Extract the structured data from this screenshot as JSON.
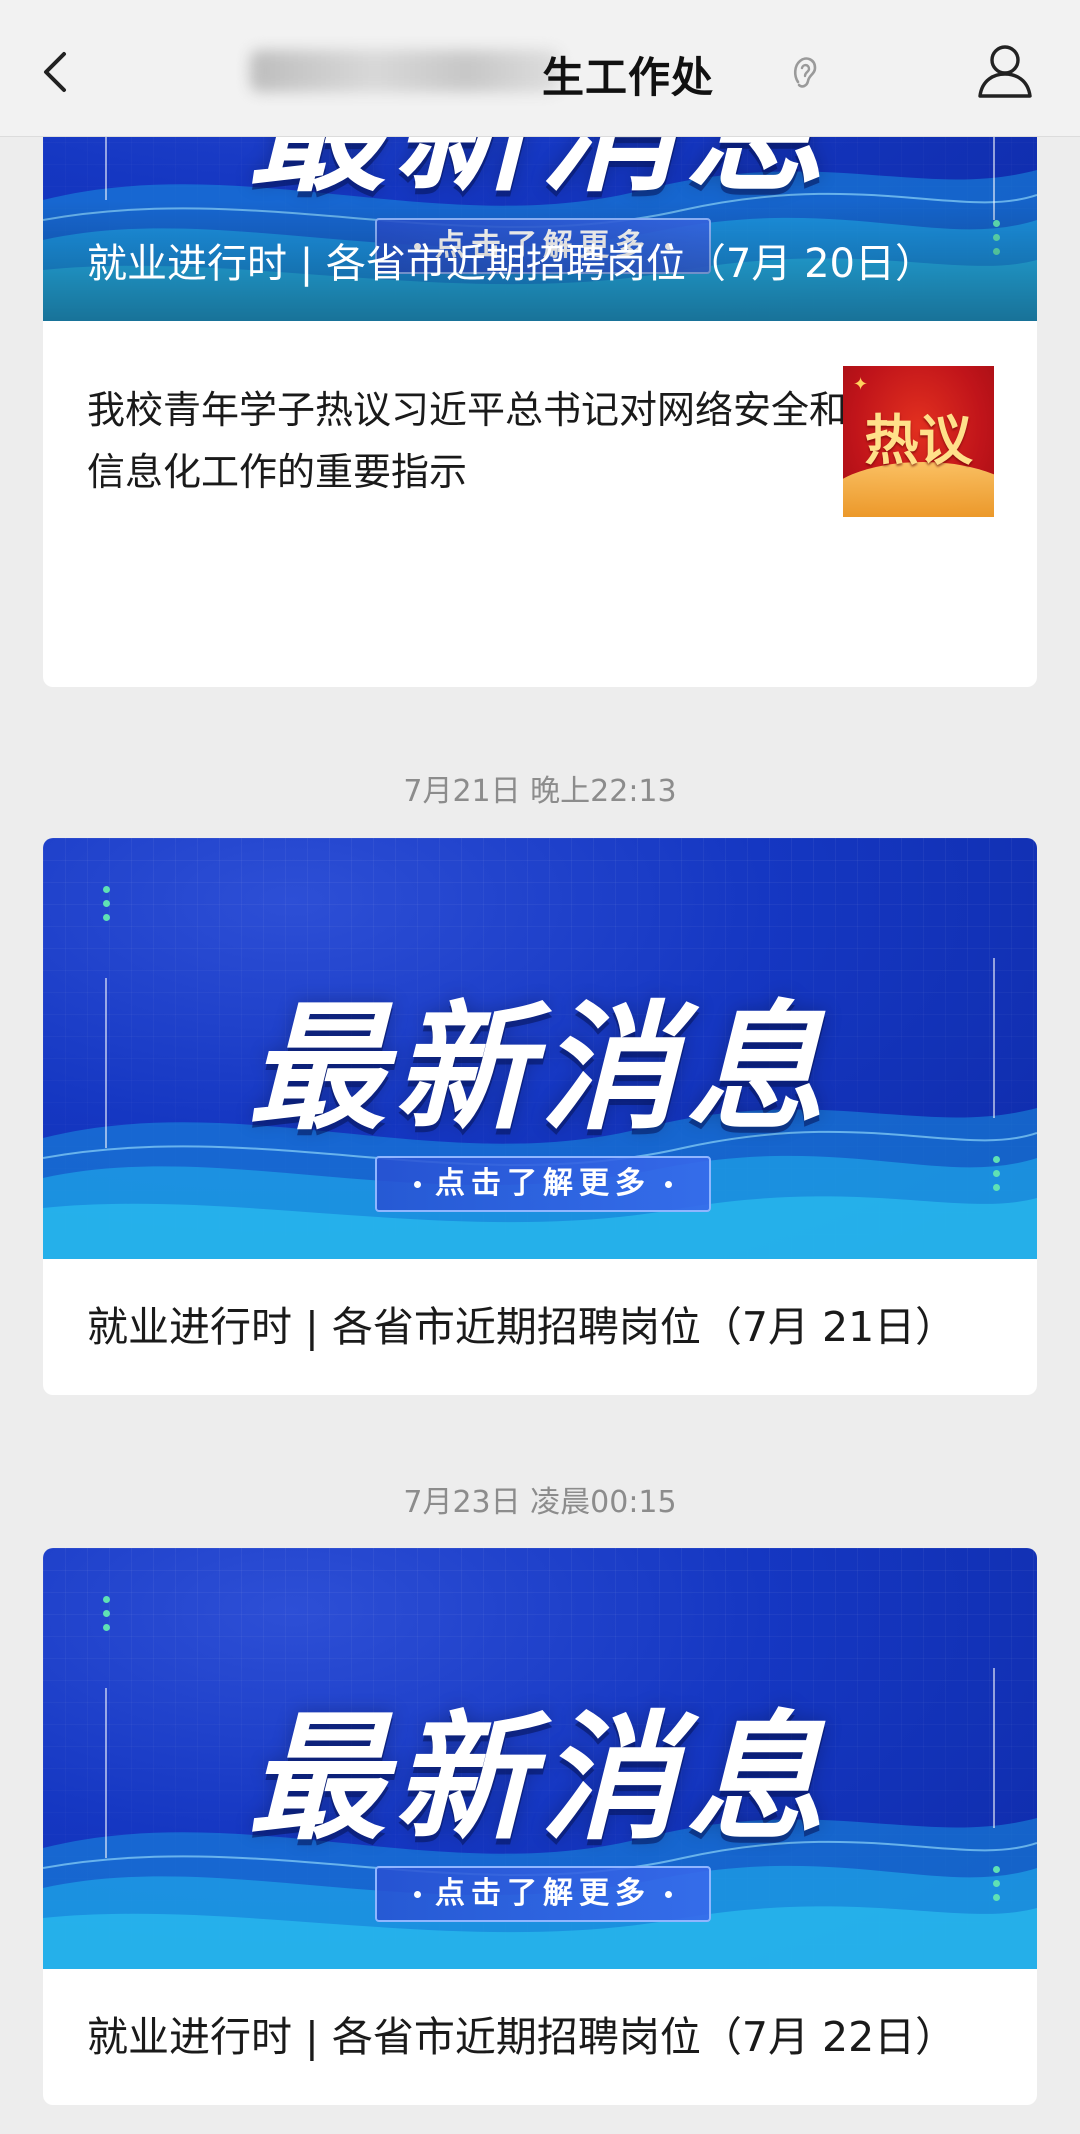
{
  "header": {
    "title_visible": "生工作处",
    "back_icon": "chevron-left-icon",
    "ear_icon": "ear-icon",
    "user_icon": "person-icon"
  },
  "banner": {
    "title": "最新消息",
    "more": "点击了解更多"
  },
  "groups": [
    {
      "featured_title": "就业进行时 | 各省市近期招聘岗位（7月 20日）",
      "sub_article": {
        "title": "我校青年学子热议习近平总书记对网络安全和信息化工作的重要指示",
        "thumb_label": "热议"
      }
    },
    {
      "timestamp": "7月21日 晚上22:13",
      "title": "就业进行时 | 各省市近期招聘岗位（7月 21日）"
    },
    {
      "timestamp": "7月23日 凌晨00:15",
      "title": "就业进行时 | 各省市近期招聘岗位（7月 22日）"
    }
  ],
  "colors": {
    "banner_blue": "#1537c2",
    "accent_green": "#5fe1b4",
    "page_bg": "#ededed"
  }
}
